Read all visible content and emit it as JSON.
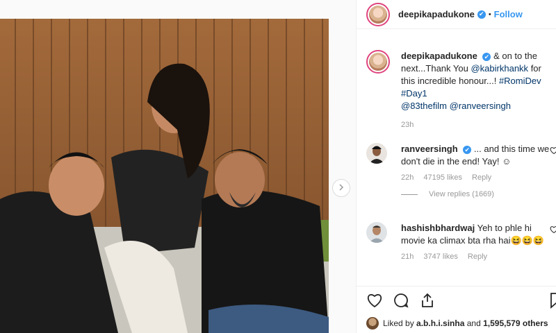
{
  "post": {
    "username": "deepikapadukone",
    "verified_glyph": "✔",
    "separator": "•",
    "follow_label": "Follow"
  },
  "caption": {
    "username": "deepikapadukone",
    "text_1": "& on to the next...Thank You",
    "mention_1": "@kabirkhankk",
    "text_2": "for this incredible honour...!",
    "hashtag_1": "#RomiDev",
    "hashtag_2": "#Day1",
    "mention_2": "@83thefilm",
    "mention_3": "@ranveersingh",
    "time": "23h"
  },
  "comments": [
    {
      "username": "ranveersingh",
      "text": "... and this time we don't die in the end! Yay! ☺",
      "time": "22h",
      "likes": "47195 likes",
      "reply_label": "Reply",
      "view_replies": "View replies (1669)"
    },
    {
      "username": "hashishbhardwaj",
      "text": "Yeh to phle hi movie ka climax bta rha hai😆😆😆",
      "time": "21h",
      "likes": "3747 likes",
      "reply_label": "Reply"
    }
  ],
  "footer": {
    "liked_prefix": "Liked by",
    "liked_user": "a.b.h.i.sinha",
    "liked_and": "and",
    "liked_count": "1,595,579",
    "liked_suffix": "others"
  },
  "icons": [
    "heart-icon",
    "comment-icon",
    "share-icon",
    "bookmark-icon",
    "chevron-right-icon",
    "verified-icon"
  ],
  "colors": {
    "link": "#003569",
    "follow": "#3897f0",
    "verified": "#3897f0",
    "story_ring": "#e0447e"
  }
}
